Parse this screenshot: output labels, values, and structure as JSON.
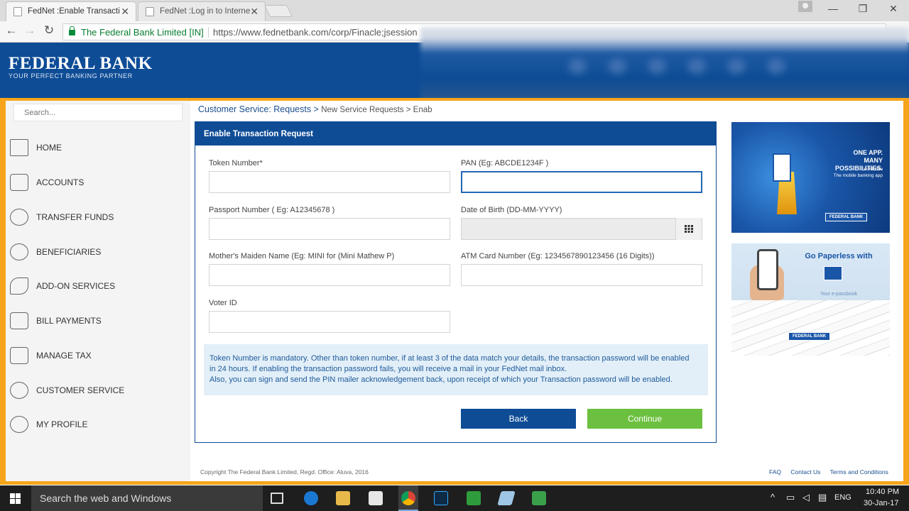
{
  "browser": {
    "tabs": [
      {
        "title": "FedNet :Enable Transacti",
        "active": true
      },
      {
        "title": "FedNet :Log in to Interne",
        "active": false
      }
    ],
    "site_identity": "The Federal Bank Limited [IN]",
    "url": "https://www.fednetbank.com/corp/Finacle;jsession"
  },
  "brand": {
    "name": "FEDERAL BANK",
    "tagline": "YOUR PERFECT BANKING PARTNER",
    "primary_color": "#0e4c96",
    "accent_color": "#f6a51b"
  },
  "sidebar": {
    "search_placeholder": "Search...",
    "items": [
      {
        "label": "HOME",
        "icon": "home-icon"
      },
      {
        "label": "ACCOUNTS",
        "icon": "accounts-icon"
      },
      {
        "label": "TRANSFER FUNDS",
        "icon": "rupee-transfer-icon"
      },
      {
        "label": "BENEFICIARIES",
        "icon": "people-icon"
      },
      {
        "label": "ADD-ON SERVICES",
        "icon": "wrench-icon"
      },
      {
        "label": "BILL PAYMENTS",
        "icon": "bill-icon"
      },
      {
        "label": "MANAGE TAX",
        "icon": "tax-icon"
      },
      {
        "label": "CUSTOMER SERVICE",
        "icon": "headset-icon"
      },
      {
        "label": "MY PROFILE",
        "icon": "profile-icon"
      }
    ]
  },
  "breadcrumb": {
    "main": "Customer Service: Requests >",
    "sub": "New Service Requests > Enab"
  },
  "form": {
    "title": "Enable Transaction Request",
    "fields": {
      "token_number": {
        "label": "Token Number*",
        "value": ""
      },
      "pan": {
        "label": "PAN (Eg: ABCDE1234F )",
        "value": ""
      },
      "passport": {
        "label": "Passport Number ( Eg: A12345678 )",
        "value": ""
      },
      "dob": {
        "label": "Date of Birth (DD-MM-YYYY)",
        "value": ""
      },
      "maiden_name": {
        "label": "Mother's Maiden Name (Eg: MINI for (Mini Mathew P)",
        "value": ""
      },
      "atm_card": {
        "label": "ATM Card Number (Eg: 1234567890123456 (16 Digits))",
        "value": ""
      },
      "voter_id": {
        "label": "Voter ID",
        "value": ""
      }
    },
    "info_lines": [
      "Token Number is mandatory. Other than token number, if at least 3 of the data match your details, the transaction password will be enabled",
      "in 24 hours. If enabling the transaction password fails, you will receive a mail in your FedNet mail inbox.",
      "Also, you can sign and send the PIN mailer acknowledgement back, upon receipt of which your Transaction password will be enabled."
    ],
    "back_label": "Back",
    "continue_label": "Continue"
  },
  "ads": {
    "ad1": {
      "title_line1": "ONE APP.",
      "title_line2": "MANY POSSIBILITIES.",
      "product": "FedMobile",
      "product_sub": "The mobile banking app",
      "badge": "FEDERAL BANK"
    },
    "ad2": {
      "title": "Go Paperless with",
      "sub": "Your e-passbook",
      "badge": "FEDERAL BANK"
    }
  },
  "footer": {
    "copyright": "Copyright The Federal Bank Limited, Regd. Office: Aluva, 2016",
    "links": [
      "FAQ",
      "Contact Us",
      "Terms and Conditions"
    ]
  },
  "taskbar": {
    "search_placeholder": "Search the web and Windows",
    "language": "ENG",
    "time": "10:40 PM",
    "date": "30-Jan-17"
  }
}
